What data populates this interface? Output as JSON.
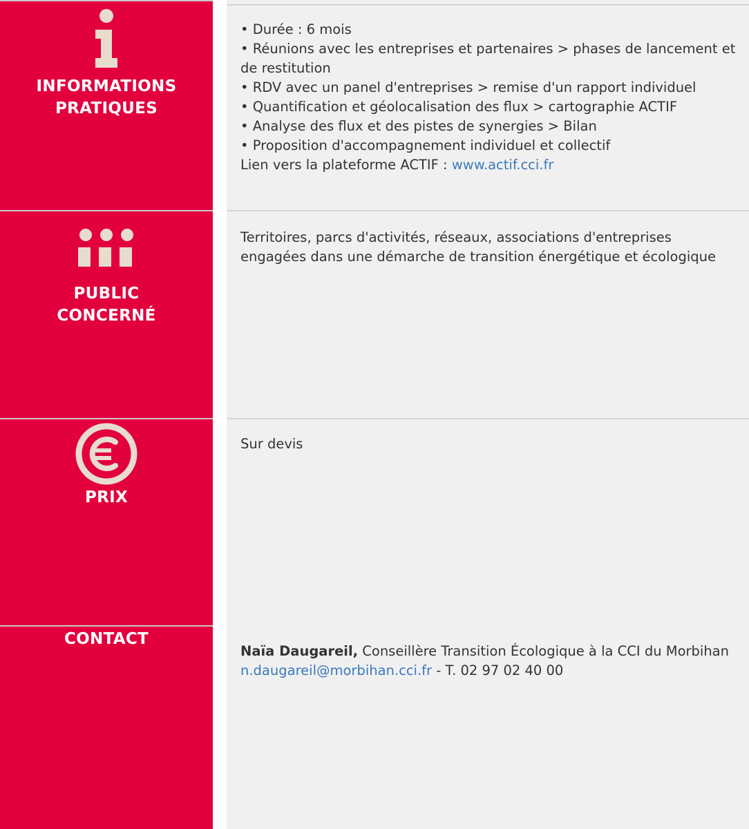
{
  "sections": {
    "informations": {
      "title_line1": "INFORMATIONS",
      "title_line2": "PRATIQUES",
      "icon": "info-icon",
      "items": [
        "• Durée : 6 mois",
        "• Réunions avec les entreprises et partenaires > phases de lancement et de restitution",
        "• RDV avec un panel d'entreprises > remise d'un rapport individuel",
        "• Quantification et géolocalisation des flux > cartographie ACTIF",
        "• Analyse des flux et des pistes de synergies > Bilan",
        "• Proposition d'accompagnement individuel et collectif"
      ],
      "link_prefix": "Lien vers la plateforme ACTIF : ",
      "link_text": "www.actif.cci.fr"
    },
    "public": {
      "title_line1": "PUBLIC",
      "title_line2": "CONCERNÉ",
      "icon": "people-group-icon",
      "text": "Territoires, parcs d'activités, réseaux, associations d'entreprises engagées dans une démarche de transition énergétique et écologique"
    },
    "prix": {
      "title": "PRIX",
      "icon": "euro-icon",
      "text": "Sur devis"
    },
    "contact": {
      "title": "CONTACT",
      "name": "Naïa Daugareil,",
      "role": " Conseillère Transition Écologique à la CCI du Morbihan",
      "email": "n.daugareil@morbihan.cci.fr",
      "phone": " - T. 02 97 02 40 00"
    }
  },
  "colors": {
    "accent_red": "#e2003d",
    "icon_beige": "#e8dccd",
    "content_bg": "#f0f0f0",
    "link_blue": "#3a7ab8",
    "text_gray": "#333333"
  }
}
